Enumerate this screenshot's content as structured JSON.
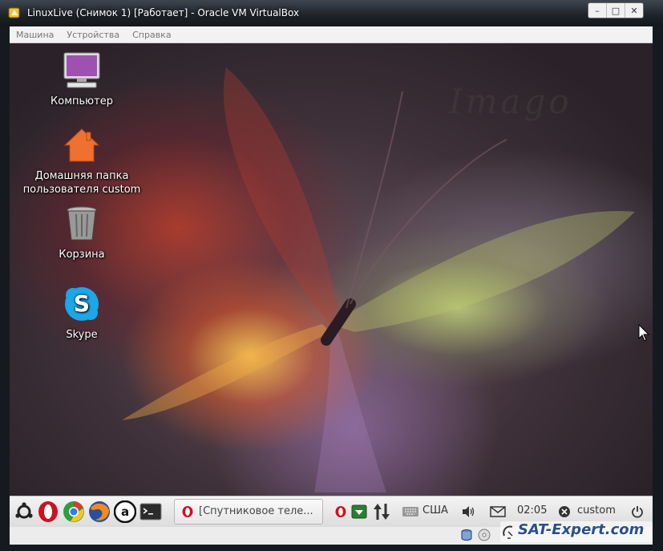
{
  "window": {
    "title": "LinuxLive (Снимок 1) [Работает] - Oracle VM VirtualBox",
    "controls": [
      "–",
      "□",
      "✕"
    ]
  },
  "menu": [
    "Машина",
    "Устройства",
    "Справка"
  ],
  "desktop": {
    "wallpaper_text": "Imago",
    "icons": [
      {
        "label": "Компьютер",
        "icon": "computer-icon"
      },
      {
        "label": "Домашняя папка пользователя custom",
        "icon": "home-folder-icon"
      },
      {
        "label": "Корзина",
        "icon": "trash-icon"
      },
      {
        "label": "Skype",
        "icon": "skype-icon"
      }
    ]
  },
  "panel": {
    "launchers": [
      "ubuntu-logo-icon",
      "opera-icon",
      "chrome-icon",
      "firefox-icon",
      "amazon-icon",
      "terminal-icon"
    ],
    "task": {
      "label": "[Спутниковое теле..."
    },
    "keyboard_layout": "США",
    "clock": "02:05",
    "user": "custom"
  },
  "watermark": "SAT-Expert.com",
  "colors": {
    "panel": "#e8e8e8",
    "titlebar": "#1e2329",
    "orange": "#f07030",
    "skype": "#1ba7e8",
    "opera": "#d01020"
  }
}
